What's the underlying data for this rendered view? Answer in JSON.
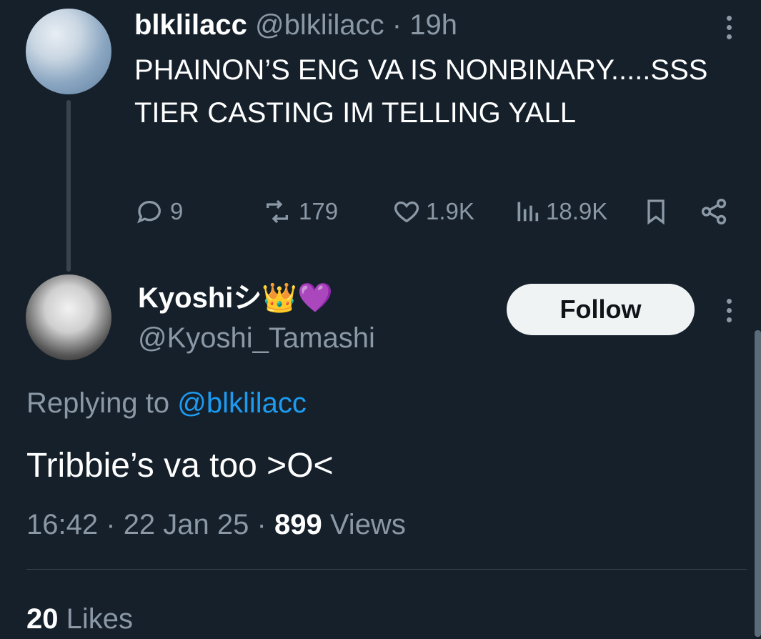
{
  "parent_tweet": {
    "display_name": "blklilacc",
    "handle": "@blklilacc",
    "separator": "·",
    "time": "19h",
    "text": "PHAINON’S ENG VA IS NONBINARY.....SSS TIER CASTING IM TELLING YALL",
    "actions": {
      "replies": "9",
      "reposts": "179",
      "likes": "1.9K",
      "views": "18.9K"
    }
  },
  "reply_tweet": {
    "display_name": "Kyoshiシ",
    "name_emojis": "👑💜",
    "handle": "@Kyoshi_Tamashi",
    "follow_label": "Follow",
    "replying_prefix": "Replying to",
    "replying_handle": "@blklilacc",
    "text": "Tribbie’s va too >O<",
    "time": "16:42",
    "date": "22 Jan 25",
    "separator": "·",
    "views_count": "899",
    "views_label": "Views",
    "likes_count": "20",
    "likes_label": "Likes"
  },
  "colors": {
    "background": "#15202b",
    "secondary_text": "#8b98a5",
    "accent": "#1d9bf0",
    "divider": "#38444d"
  },
  "icons": [
    "more-icon",
    "reply-icon",
    "repost-icon",
    "like-icon",
    "views-icon",
    "bookmark-icon",
    "share-icon"
  ]
}
